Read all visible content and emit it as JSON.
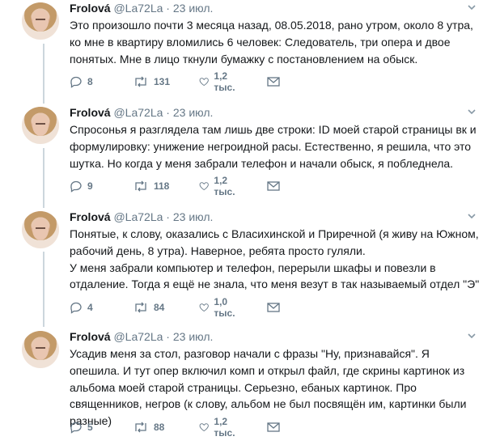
{
  "tweets": [
    {
      "name": "Frolová",
      "handle": "@La72La",
      "dot": "·",
      "date": "23 июл.",
      "paragraphs": [
        "Это произошло почти 3 месяца назад, 08.05.2018, рано утром, около 8 утра, ко мне в квартиру вломились 6 человек: Следователь, три опера и двое понятых. Мне в лицо ткнули бумажку с постановлением на обыск."
      ],
      "replies": "8",
      "retweets": "131",
      "likes": "1,2 тыс."
    },
    {
      "name": "Frolová",
      "handle": "@La72La",
      "dot": "·",
      "date": "23 июл.",
      "paragraphs": [
        "Спросонья я разглядела там лишь две строки: ID моей старой страницы вк и формулировку: унижение негроидной расы. Естественно, я решила, что это шутка. Но когда у меня забрали телефон и начали обыск, я побледнела."
      ],
      "replies": "9",
      "retweets": "118",
      "likes": "1,2 тыс."
    },
    {
      "name": "Frolová",
      "handle": "@La72La",
      "dot": "·",
      "date": "23 июл.",
      "paragraphs": [
        "Понятые, к слову, оказались с Власихинской и Приречной (я живу на Южном, рабочий день, 8 утра). Наверное, ребята просто гуляли.",
        "У меня забрали компьютер и телефон, перерыли шкафы и повезли в отдаление. Тогда я ещё не знала, что меня везут в так называемый отдел \"Э\""
      ],
      "replies": "4",
      "retweets": "84",
      "likes": "1,0 тыс."
    },
    {
      "name": "Frolová",
      "handle": "@La72La",
      "dot": "·",
      "date": "23 июл.",
      "paragraphs": [
        "Усадив меня за стол, разговор начали с фразы \"Ну, признавайся\". Я опешила. И тут опер включил комп и открыл файл, где скрины картинок из альбома моей старой страницы. Серьезно, ебаных картинок. Про священников, негров (к слову, альбом не был посвящён им, картинки были разные)"
      ],
      "replies": "5",
      "retweets": "88",
      "likes": "1,2 тыс."
    }
  ],
  "icons": {
    "reply": "reply-icon",
    "retweet": "retweet-icon",
    "like": "heart-icon",
    "dm": "envelope-icon",
    "more": "chevron-down-icon"
  },
  "colors": {
    "text": "#14171a",
    "muted": "#657786",
    "thread_line": "#ccd6dd"
  }
}
